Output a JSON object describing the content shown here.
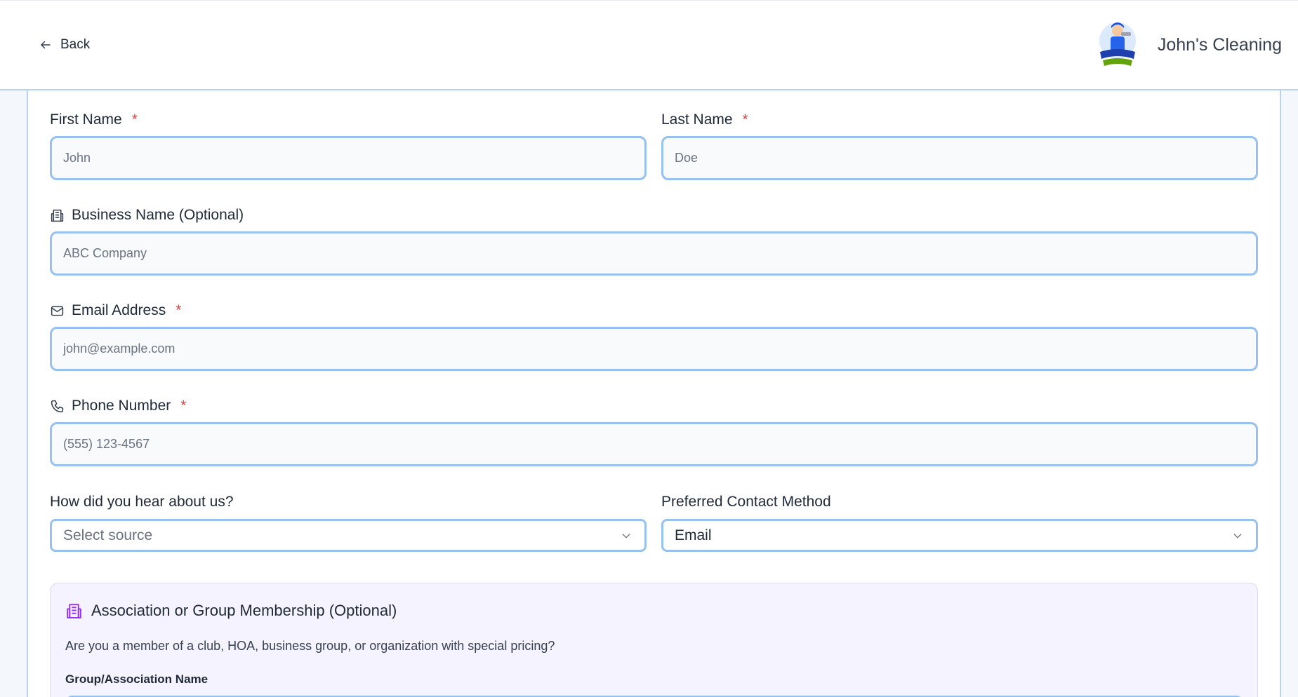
{
  "header": {
    "back_label": "Back",
    "brand_name": "John's Cleaning",
    "logo_icon": "johns-cleaning-logo"
  },
  "form": {
    "first_name": {
      "label": "First Name",
      "required": "*",
      "placeholder": "John"
    },
    "last_name": {
      "label": "Last Name",
      "required": "*",
      "placeholder": "Doe"
    },
    "business_name": {
      "label": "Business Name (Optional)",
      "icon": "building-icon",
      "placeholder": "ABC Company"
    },
    "email": {
      "label": "Email Address",
      "required": "*",
      "icon": "mail-icon",
      "placeholder": "john@example.com"
    },
    "phone": {
      "label": "Phone Number",
      "required": "*",
      "icon": "phone-icon",
      "placeholder": "(555) 123-4567"
    },
    "source": {
      "label": "How did you hear about us?",
      "value": "Select source"
    },
    "contact_method": {
      "label": "Preferred Contact Method",
      "value": "Email"
    }
  },
  "association": {
    "title": "Association or Group Membership (Optional)",
    "icon": "building-icon",
    "description": "Are you a member of a club, HOA, business group, or organization with special pricing?",
    "field_label": "Group/Association Name"
  },
  "colors": {
    "accent_border": "#97c1ef",
    "required": "#e53e3e",
    "association_bg": "#f5f3ff",
    "association_icon": "#9333ea"
  }
}
